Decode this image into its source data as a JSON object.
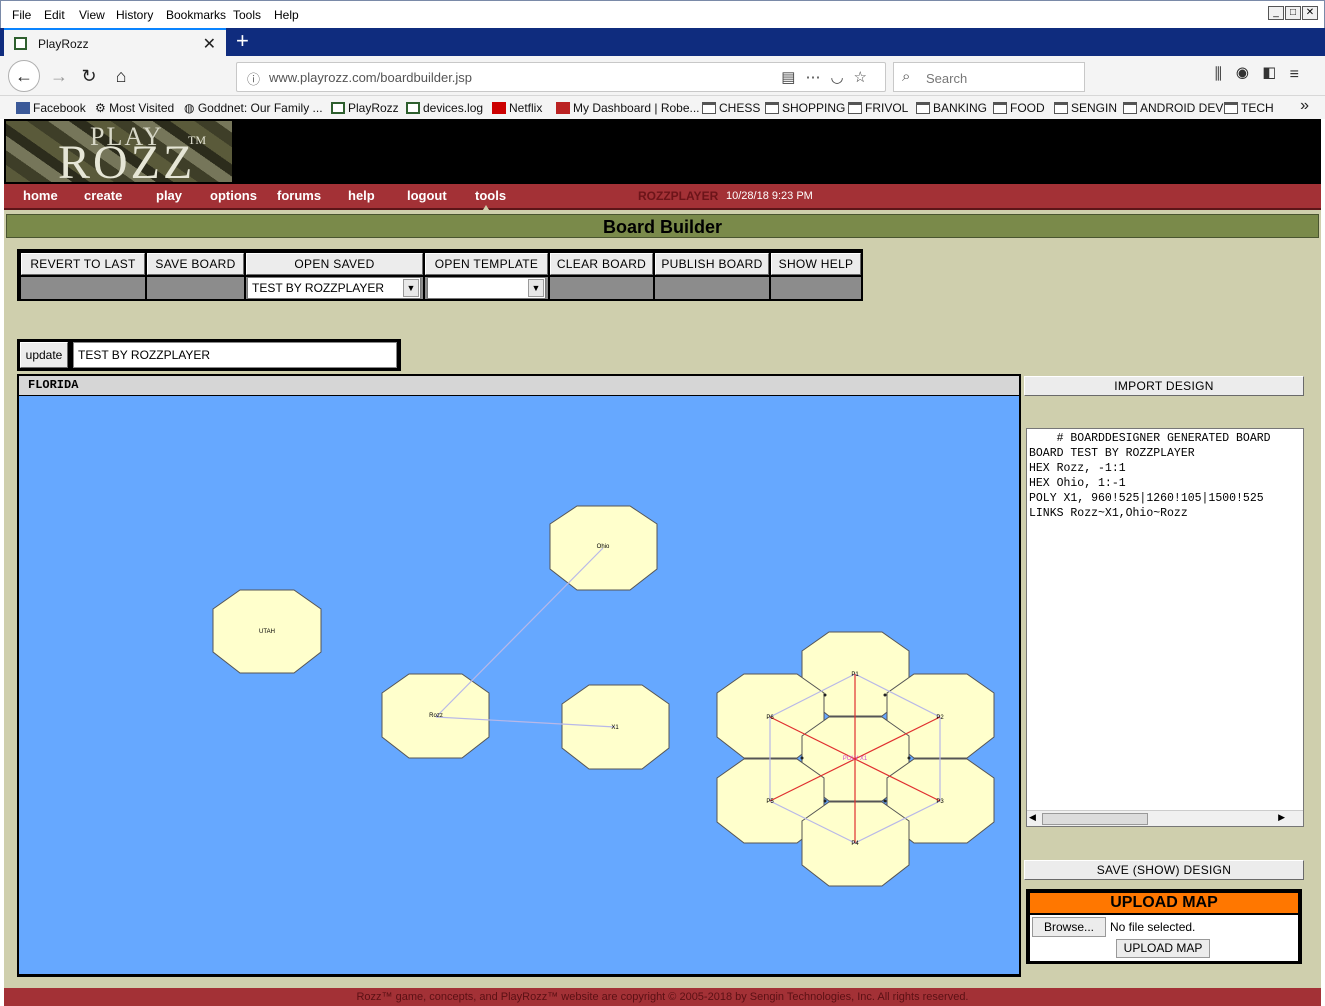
{
  "browser": {
    "menu": [
      "File",
      "Edit",
      "View",
      "History",
      "Bookmarks",
      "Tools",
      "Help"
    ],
    "tab_title": "PlayRozz",
    "url": "www.playrozz.com/boardbuilder.jsp",
    "search_placeholder": "Search",
    "bookmarks": [
      "Facebook",
      "Most Visited",
      "Goddnet: Our Family ...",
      "PlayRozz",
      "devices.log",
      "Netflix",
      "My Dashboard | Robe...",
      "CHESS",
      "SHOPPING",
      "FRIVOL",
      "BANKING",
      "FOOD",
      "SENGIN",
      "ANDROID DEV",
      "TECH"
    ]
  },
  "site": {
    "logo_play": "PLAY",
    "logo_rozz": "ROZZ",
    "logo_tm": "TM",
    "nav": [
      "home",
      "create",
      "play",
      "options",
      "forums",
      "help",
      "logout",
      "tools"
    ],
    "username": "ROZZPLAYER",
    "timestamp": "10/28/18 9:23 PM",
    "page_title": "Board Builder",
    "footer": "Rozz™ game, concepts, and PlayRozz™ website are copyright © 2005-2018 by Sengin Technologies, Inc. All rights reserved."
  },
  "toolbar": {
    "revert": "REVERT TO LAST",
    "save_board": "SAVE BOARD",
    "open_saved": "OPEN SAVED",
    "open_template": "OPEN TEMPLATE",
    "clear_board": "CLEAR BOARD",
    "publish_board": "PUBLISH BOARD",
    "show_help": "SHOW HELP",
    "saved_selected": "TEST BY ROZZPLAYER",
    "template_selected": ""
  },
  "board": {
    "update_label": "update",
    "name_value": "TEST BY ROZZPLAYER",
    "header": "FLORIDA",
    "hex_labels": {
      "utah": "UTAH",
      "ohio": "Ohio",
      "rozz": "Rozz",
      "x1": "X1",
      "p1": "P1",
      "p2": "P2",
      "p3": "P3",
      "p4": "P4",
      "p5": "P5",
      "p6": "P6",
      "center": "POLY X1"
    }
  },
  "designer": {
    "import_label": "IMPORT DESIGN",
    "design_text": "    # BOARDDESIGNER GENERATED BOARD\nBOARD TEST BY ROZZPLAYER\nHEX Rozz, -1:1\nHEX Ohio, 1:-1\nPOLY X1, 960!525|1260!105|1500!525\nLINKS Rozz~X1,Ohio~Rozz",
    "save_show_label": "SAVE (SHOW) DESIGN",
    "upload_title": "UPLOAD MAP",
    "browse_label": "Browse...",
    "no_file_text": "No file selected.",
    "upload_button": "UPLOAD MAP"
  },
  "colors": {
    "nav_bar": "#a33136",
    "title_bar": "#7a8a4a",
    "board_bg": "#66a8ff",
    "hex_fill": "#ffffcc",
    "upload_orange": "#ff7700",
    "page_bg": "#cfcfad"
  }
}
